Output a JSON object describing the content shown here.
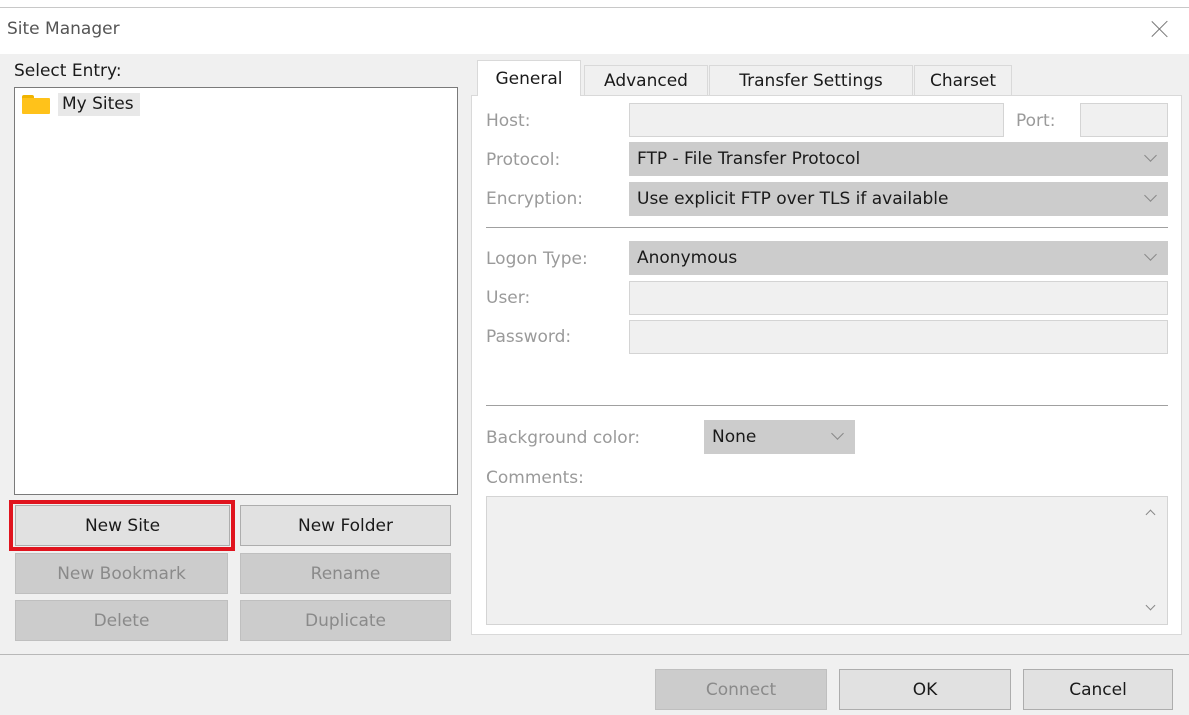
{
  "window": {
    "title": "Site Manager"
  },
  "left": {
    "select_entry_label": "Select Entry:",
    "tree": [
      {
        "label": "My Sites",
        "icon": "folder-icon"
      }
    ],
    "buttons": {
      "new_site": "New Site",
      "new_folder": "New Folder",
      "new_bookmark": "New Bookmark",
      "rename": "Rename",
      "delete": "Delete",
      "duplicate": "Duplicate"
    }
  },
  "tabs": [
    "General",
    "Advanced",
    "Transfer Settings",
    "Charset"
  ],
  "general": {
    "host_label": "Host:",
    "host_value": "",
    "port_label": "Port:",
    "port_value": "",
    "protocol_label": "Protocol:",
    "protocol_value": "FTP - File Transfer Protocol",
    "encryption_label": "Encryption:",
    "encryption_value": "Use explicit FTP over TLS if available",
    "logon_type_label": "Logon Type:",
    "logon_type_value": "Anonymous",
    "user_label": "User:",
    "user_value": "",
    "password_label": "Password:",
    "password_value": "",
    "background_color_label": "Background color:",
    "background_color_value": "None",
    "comments_label": "Comments:",
    "comments_value": ""
  },
  "footer": {
    "connect": "Connect",
    "ok": "OK",
    "cancel": "Cancel"
  },
  "colors": {
    "highlight": "#e0141e",
    "folder": "#ffc21a"
  }
}
